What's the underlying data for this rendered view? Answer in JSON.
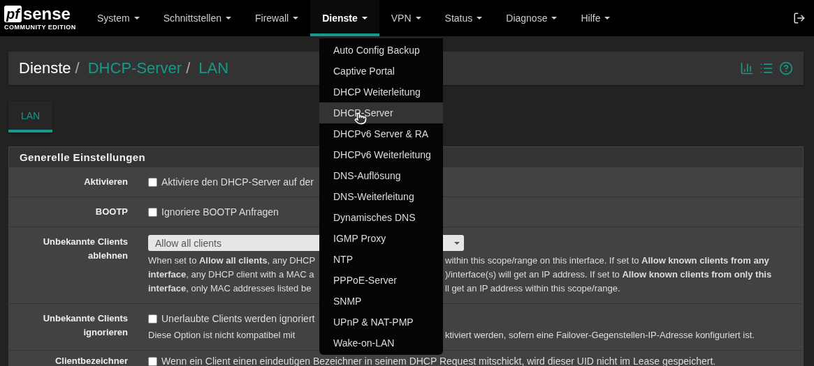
{
  "navbar": {
    "logo": {
      "mark": "pf",
      "name": "sense",
      "edition": "COMMUNITY EDITION"
    },
    "menu": [
      {
        "label": "System",
        "selected": false
      },
      {
        "label": "Schnittstellen",
        "selected": false
      },
      {
        "label": "Firewall",
        "selected": false
      },
      {
        "label": "Dienste",
        "selected": true
      },
      {
        "label": "VPN",
        "selected": false
      },
      {
        "label": "Status",
        "selected": false
      },
      {
        "label": "Diagnose",
        "selected": false
      },
      {
        "label": "Hilfe",
        "selected": false
      }
    ]
  },
  "dropdown": [
    {
      "label": "Auto Config Backup",
      "selected": false
    },
    {
      "label": "Captive Portal",
      "selected": false
    },
    {
      "label": "DHCP Weiterleitung",
      "selected": false
    },
    {
      "label": "DHCP-Server",
      "selected": true
    },
    {
      "label": "DHCPv6 Server & RA",
      "selected": false
    },
    {
      "label": "DHCPv6 Weiterleitung",
      "selected": false
    },
    {
      "label": "DNS-Auflösung",
      "selected": false
    },
    {
      "label": "DNS-Weiterleitung",
      "selected": false
    },
    {
      "label": "Dynamisches DNS",
      "selected": false
    },
    {
      "label": "IGMP Proxy",
      "selected": false
    },
    {
      "label": "NTP",
      "selected": false
    },
    {
      "label": "PPPoE-Server",
      "selected": false
    },
    {
      "label": "SNMP",
      "selected": false
    },
    {
      "label": "UPnP & NAT-PMP",
      "selected": false
    },
    {
      "label": "Wake-on-LAN",
      "selected": false
    }
  ],
  "breadcrumb": {
    "separator": "/",
    "items": [
      {
        "label": "Dienste",
        "link": false
      },
      {
        "label": "DHCP-Server",
        "link": true
      },
      {
        "label": "LAN",
        "link": true
      }
    ]
  },
  "tabs": [
    {
      "label": "LAN",
      "selected": true
    }
  ],
  "section": {
    "title": "Generelle Einstellungen",
    "rows": [
      {
        "kind": "checkbox",
        "label": "Aktivieren",
        "checked": false,
        "text": "Aktiviere den DHCP-Server auf der"
      },
      {
        "kind": "checkbox",
        "label": "BOOTP",
        "checked": false,
        "text": "Ignoriere BOOTP Anfragen"
      },
      {
        "kind": "select",
        "label": "Unbekannte Clients ablehnen",
        "value": "Allow all clients",
        "help_lines": [
          {
            "left": "When set to **Allow all clients**, any DHCP",
            "right": "within this scope/range on this interface. If set to **Allow known clients from any**"
          },
          {
            "left": "**interface**, any DHCP client with a MAC a",
            "right": ")/interface(s) will get an IP address. If set to **Allow known clients from only this**"
          },
          {
            "left": "**interface**, only MAC addresses listed be",
            "right": "ll get an IP address within this scope/range."
          }
        ]
      },
      {
        "kind": "checkbox",
        "label": "Unbekannte Clients ignorieren",
        "checked": false,
        "text": "Unerlaubte Clients werden ignoriert",
        "help_lines": [
          {
            "left": "Diese Option ist nicht kompatibel mit",
            "right": "ktiviert werden, sofern eine Failover-Gegenstellen-IP-Adresse konfiguriert ist."
          }
        ]
      },
      {
        "kind": "checkbox",
        "label": "Clientbezeichner",
        "checked": false,
        "text": "Wenn ein Client einen eindeutigen Bezeichner in seinem DHCP Request mitschickt, wird dieser UID nicht im Lease gespeichert."
      }
    ]
  }
}
